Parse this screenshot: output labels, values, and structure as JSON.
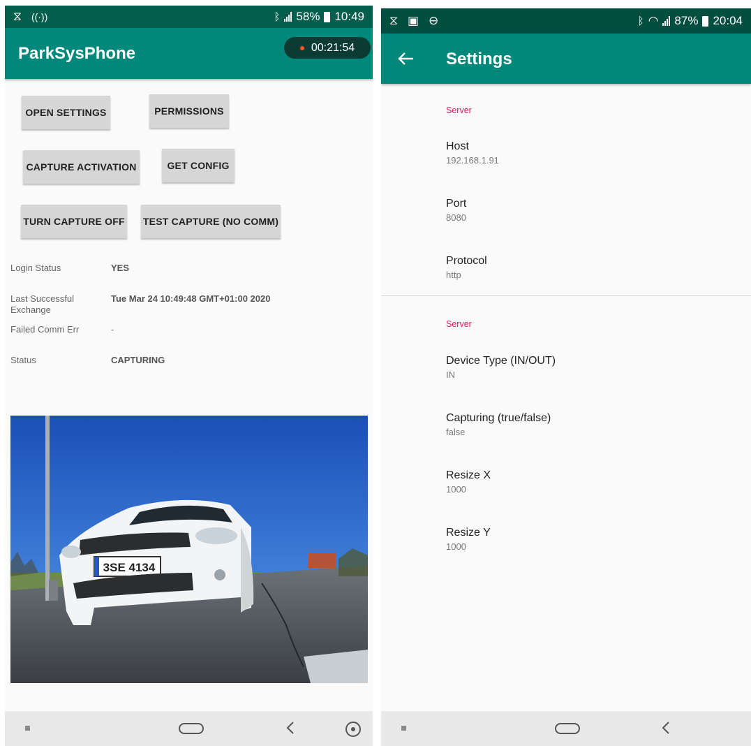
{
  "left": {
    "status_time": "10:49",
    "status_battery": "58%",
    "app_title": "ParkSysPhone",
    "timer": "00:21:54",
    "buttons": {
      "open_settings": "OPEN SETTINGS",
      "permissions": "PERMISSIONS",
      "capture_activation": "CAPTURE ACTIVATION",
      "get_config": "GET CONFIG",
      "turn_capture_off": "TURN CAPTURE OFF",
      "test_capture": "TEST CAPTURE (NO COMM)"
    },
    "info": {
      "login_status_label": "Login Status",
      "login_status_value": "YES",
      "last_exchange_label": "Last Successful Exchange",
      "last_exchange_value": "Tue Mar 24 10:49:48 GMT+01:00 2020",
      "failed_comm_label": "Failed Comm Err",
      "failed_comm_value": "-",
      "status_label": "Status",
      "status_value": "CAPTURING"
    },
    "photo": {
      "plate": "3SE 4134"
    }
  },
  "right": {
    "status_time": "20:04",
    "status_battery": "87%",
    "title": "Settings",
    "sections": [
      {
        "header": "Server",
        "prefs": [
          {
            "title": "Host",
            "summary": "192.168.1.91"
          },
          {
            "title": "Port",
            "summary": "8080"
          },
          {
            "title": "Protocol",
            "summary": "http"
          }
        ]
      },
      {
        "header": "Server",
        "prefs": [
          {
            "title": "Device Type (IN/OUT)",
            "summary": "IN"
          },
          {
            "title": "Capturing (true/false)",
            "summary": "false"
          },
          {
            "title": "Resize X",
            "summary": "1000"
          },
          {
            "title": "Resize Y",
            "summary": "1000"
          }
        ]
      }
    ]
  },
  "colors": {
    "status_bar": "#035e4e",
    "app_bar": "#00897b",
    "section_header": "#d81b60",
    "button": "#d6d6d6"
  },
  "icons": [
    "hourglass-icon",
    "wifi-calling-icon",
    "bluetooth-icon",
    "signal-icon",
    "battery-icon",
    "gallery-icon",
    "do-not-disturb-icon",
    "wifi-icon",
    "back-arrow-icon",
    "recent-apps-icon",
    "home-icon",
    "nav-back-icon",
    "assistant-icon"
  ]
}
